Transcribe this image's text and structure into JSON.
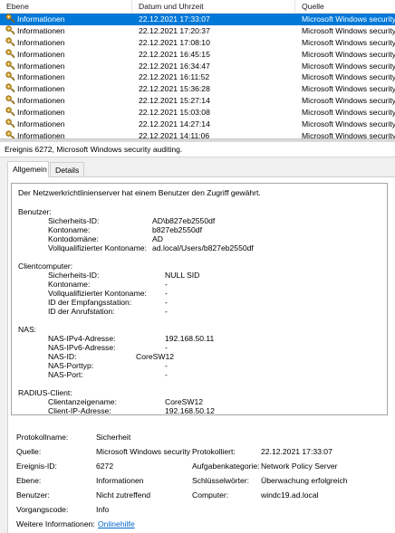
{
  "list": {
    "columns": [
      "Ebene",
      "Datum und Uhrzeit",
      "Quelle"
    ],
    "rows": [
      {
        "level": "Informationen",
        "datetime": "22.12.2021 17:33:07",
        "source": "Microsoft Windows security a"
      },
      {
        "level": "Informationen",
        "datetime": "22.12.2021 17:20:37",
        "source": "Microsoft Windows security a"
      },
      {
        "level": "Informationen",
        "datetime": "22.12.2021 17:08:10",
        "source": "Microsoft Windows security a"
      },
      {
        "level": "Informationen",
        "datetime": "22.12.2021 16:45:15",
        "source": "Microsoft Windows security a"
      },
      {
        "level": "Informationen",
        "datetime": "22.12.2021 16:34:47",
        "source": "Microsoft Windows security a"
      },
      {
        "level": "Informationen",
        "datetime": "22.12.2021 16:11:52",
        "source": "Microsoft Windows security a"
      },
      {
        "level": "Informationen",
        "datetime": "22.12.2021 15:36:28",
        "source": "Microsoft Windows security a"
      },
      {
        "level": "Informationen",
        "datetime": "22.12.2021 15:27:14",
        "source": "Microsoft Windows security a"
      },
      {
        "level": "Informationen",
        "datetime": "22.12.2021 15:03:08",
        "source": "Microsoft Windows security a"
      },
      {
        "level": "Informationen",
        "datetime": "22.12.2021 14:27:14",
        "source": "Microsoft Windows security a"
      },
      {
        "level": "Informationen",
        "datetime": "22.12.2021 14:11:06",
        "source": "Microsoft Windows security a"
      }
    ]
  },
  "detail": {
    "title": "Ereignis 6272, Microsoft Windows security auditing.",
    "tabs": [
      "Allgemein",
      "Details"
    ]
  },
  "description": {
    "intro": "Der Netzwerkrichtlinienserver hat einem Benutzer den Zugriff gewährt.",
    "benutzer": {
      "heading": "Benutzer:",
      "sid_label": "Sicherheits-ID:",
      "sid": "AD\\b827eb2550df",
      "account_label": "Kontoname:",
      "account": "b827eb2550df",
      "domain_label": "Kontodomäne:",
      "domain": "AD",
      "fq_label": "Vollqualifizierter Kontoname:",
      "fq": "ad.local/Users/b827eb2550df"
    },
    "clientcomputer": {
      "heading": "Clientcomputer:",
      "sid_label": "Sicherheits-ID:",
      "sid": "NULL SID",
      "account_label": "Kontoname:",
      "account": "-",
      "fq_label": "Vollqualifizierter Kontoname:",
      "fq": "-",
      "called_label": "ID der Empfangsstation:",
      "called": "-",
      "calling_label": "ID der Anrufstation:",
      "calling": "-"
    },
    "nas": {
      "heading": "NAS:",
      "ipv4_label": "NAS-IPv4-Adresse:",
      "ipv4": "192.168.50.11",
      "ipv6_label": "NAS-IPv6-Adresse:",
      "ipv6": "-",
      "id_label": "NAS-ID:",
      "id": "CoreSW12",
      "porttype_label": "NAS-Porttyp:",
      "porttype": "-",
      "port_label": "NAS-Port:",
      "port": "-"
    },
    "radius": {
      "heading": "RADIUS-Client:",
      "name_label": "Clientanzeigename:",
      "name": "CoreSW12",
      "ip_label": "Client-IP-Adresse:",
      "ip": "192.168.50.12"
    }
  },
  "fields": {
    "log_label": "Protokollname:",
    "log": "Sicherheit",
    "source_label": "Quelle:",
    "source": "Microsoft Windows security",
    "logged_label": "Protokolliert:",
    "logged": "22.12.2021 17:33:07",
    "eventid_label": "Ereignis-ID:",
    "eventid": "6272",
    "task_label": "Aufgabenkategorie:",
    "task": "Network Policy Server",
    "level_label": "Ebene:",
    "level": "Informationen",
    "keywords_label": "Schlüsselwörter:",
    "keywords": "Überwachung erfolgreich",
    "user_label": "Benutzer:",
    "user": "Nicht zutreffend",
    "computer_label": "Computer:",
    "computer": "windc19.ad.local",
    "opcode_label": "Vorgangscode:",
    "opcode": "Info",
    "more_label": "Weitere Informationen:",
    "more_link": "Onlinehilfe"
  }
}
